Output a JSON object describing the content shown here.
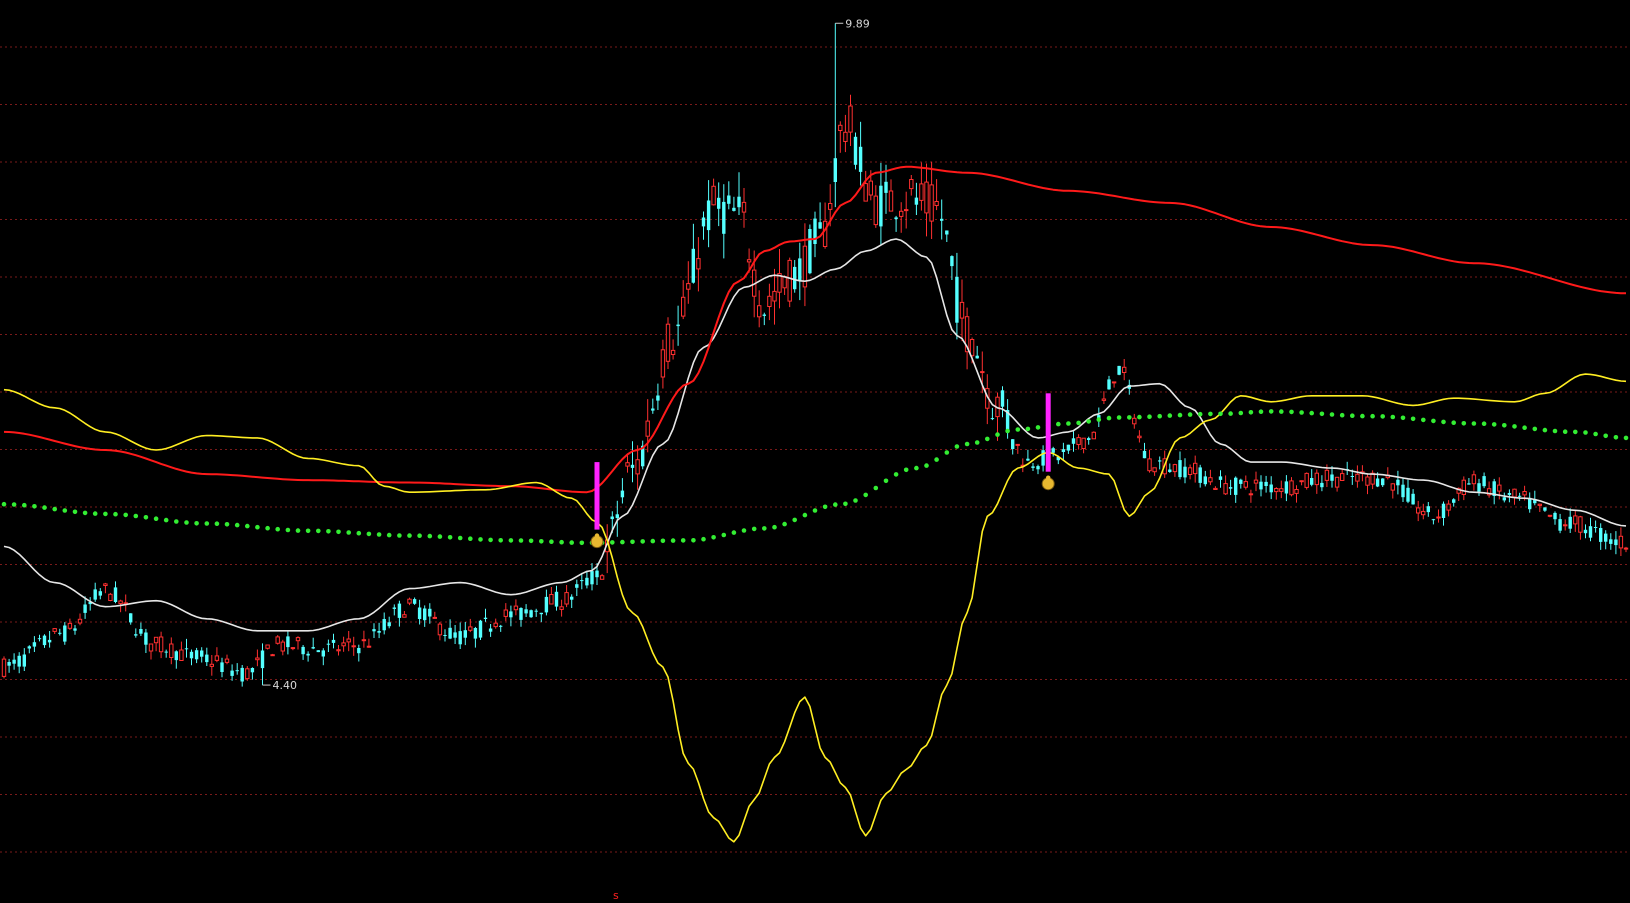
{
  "colors": {
    "background": "#000000",
    "grid": "#7a1a1a",
    "up": "#ff3030",
    "down": "#54ffff",
    "ma_white": "#e6e6e6",
    "ma_red": "#ff1a1a",
    "band_yellow": "#ffee22",
    "dots_green": "#33ee33",
    "signal_magenta": "#ff22ff",
    "signal_icon": "#e8b830"
  },
  "chart_data": {
    "type": "candlestick",
    "grid": true,
    "bars": 321,
    "ylim": [
      2.7,
      10.0
    ],
    "annotations": {
      "high": {
        "value": 9.89,
        "bar": 164,
        "text": "9.89"
      },
      "low": {
        "value": 4.4,
        "bar": 51,
        "text": "4.40"
      },
      "bottom_marker": {
        "text": "s"
      }
    },
    "signals": [
      {
        "bar": 117,
        "top": 6.25,
        "bottom": 5.69,
        "icon": "money-bag-icon"
      },
      {
        "bar": 206,
        "top": 6.82,
        "bottom": 6.17,
        "icon": "money-bag-icon"
      }
    ],
    "series": [
      {
        "style": "candles",
        "path": [
          [
            0,
            4.55
          ],
          [
            12,
            4.83
          ],
          [
            20,
            5.18
          ],
          [
            30,
            4.73
          ],
          [
            38,
            4.63
          ],
          [
            48,
            4.5
          ],
          [
            54,
            4.73
          ],
          [
            64,
            4.7
          ],
          [
            70,
            4.73
          ],
          [
            80,
            5.05
          ],
          [
            90,
            4.8
          ],
          [
            100,
            4.98
          ],
          [
            110,
            5.1
          ],
          [
            117,
            5.3
          ],
          [
            124,
            6.18
          ],
          [
            132,
            7.3
          ],
          [
            140,
            8.35
          ],
          [
            145,
            8.3
          ],
          [
            150,
            7.55
          ],
          [
            156,
            7.8
          ],
          [
            161,
            8.1
          ],
          [
            166,
            9.05
          ],
          [
            172,
            8.4
          ],
          [
            178,
            8.45
          ],
          [
            184,
            8.35
          ],
          [
            190,
            7.35
          ],
          [
            196,
            6.72
          ],
          [
            202,
            6.25
          ],
          [
            208,
            6.3
          ],
          [
            214,
            6.45
          ],
          [
            220,
            7.02
          ],
          [
            226,
            6.25
          ],
          [
            232,
            6.2
          ],
          [
            242,
            6.05
          ],
          [
            252,
            6.05
          ],
          [
            262,
            6.12
          ],
          [
            272,
            6.12
          ],
          [
            282,
            5.8
          ],
          [
            290,
            6.08
          ],
          [
            298,
            5.95
          ],
          [
            308,
            5.75
          ],
          [
            320,
            5.58
          ]
        ]
      },
      {
        "style": "line",
        "color_key": "ma_white",
        "path": [
          [
            0,
            5.55
          ],
          [
            10,
            5.25
          ],
          [
            20,
            5.05
          ],
          [
            30,
            5.1
          ],
          [
            40,
            4.95
          ],
          [
            50,
            4.85
          ],
          [
            60,
            4.85
          ],
          [
            70,
            4.95
          ],
          [
            80,
            5.2
          ],
          [
            90,
            5.25
          ],
          [
            100,
            5.15
          ],
          [
            110,
            5.25
          ],
          [
            116,
            5.35
          ],
          [
            122,
            5.8
          ],
          [
            130,
            6.4
          ],
          [
            138,
            7.2
          ],
          [
            146,
            7.7
          ],
          [
            152,
            7.8
          ],
          [
            158,
            7.75
          ],
          [
            164,
            7.85
          ],
          [
            170,
            8.0
          ],
          [
            176,
            8.1
          ],
          [
            182,
            7.95
          ],
          [
            188,
            7.3
          ],
          [
            196,
            6.7
          ],
          [
            204,
            6.45
          ],
          [
            210,
            6.5
          ],
          [
            216,
            6.65
          ],
          [
            222,
            6.88
          ],
          [
            228,
            6.9
          ],
          [
            234,
            6.7
          ],
          [
            240,
            6.4
          ],
          [
            246,
            6.25
          ],
          [
            252,
            6.25
          ],
          [
            262,
            6.2
          ],
          [
            270,
            6.15
          ],
          [
            280,
            6.1
          ],
          [
            290,
            6.0
          ],
          [
            300,
            5.95
          ],
          [
            310,
            5.85
          ],
          [
            320,
            5.72
          ]
        ]
      },
      {
        "style": "line",
        "color_key": "ma_red",
        "path": [
          [
            0,
            6.5
          ],
          [
            20,
            6.35
          ],
          [
            40,
            6.15
          ],
          [
            60,
            6.1
          ],
          [
            80,
            6.08
          ],
          [
            100,
            6.05
          ],
          [
            115,
            6.0
          ],
          [
            125,
            6.35
          ],
          [
            135,
            6.9
          ],
          [
            145,
            7.75
          ],
          [
            150,
            8.0
          ],
          [
            155,
            8.08
          ],
          [
            160,
            8.1
          ],
          [
            166,
            8.4
          ],
          [
            172,
            8.65
          ],
          [
            178,
            8.7
          ],
          [
            190,
            8.65
          ],
          [
            210,
            8.5
          ],
          [
            230,
            8.4
          ],
          [
            250,
            8.2
          ],
          [
            270,
            8.05
          ],
          [
            290,
            7.9
          ],
          [
            320,
            7.65
          ]
        ]
      },
      {
        "style": "line",
        "color_key": "band_yellow",
        "path": [
          [
            0,
            6.85
          ],
          [
            10,
            6.7
          ],
          [
            20,
            6.5
          ],
          [
            30,
            6.35
          ],
          [
            40,
            6.47
          ],
          [
            50,
            6.45
          ],
          [
            60,
            6.28
          ],
          [
            70,
            6.22
          ],
          [
            75,
            6.05
          ],
          [
            80,
            6.0
          ],
          [
            95,
            6.02
          ],
          [
            105,
            6.08
          ],
          [
            112,
            5.95
          ],
          [
            117,
            5.75
          ],
          [
            124,
            5.0
          ],
          [
            130,
            4.55
          ],
          [
            135,
            3.75
          ],
          [
            140,
            3.3
          ],
          [
            144,
            3.1
          ],
          [
            148,
            3.45
          ],
          [
            152,
            3.8
          ],
          [
            158,
            4.3
          ],
          [
            162,
            3.8
          ],
          [
            166,
            3.55
          ],
          [
            170,
            3.15
          ],
          [
            174,
            3.5
          ],
          [
            178,
            3.7
          ],
          [
            182,
            3.9
          ],
          [
            186,
            4.4
          ],
          [
            190,
            5.0
          ],
          [
            194,
            5.8
          ],
          [
            200,
            6.2
          ],
          [
            206,
            6.33
          ],
          [
            212,
            6.2
          ],
          [
            218,
            6.15
          ],
          [
            222,
            5.8
          ],
          [
            226,
            6.0
          ],
          [
            232,
            6.45
          ],
          [
            238,
            6.6
          ],
          [
            244,
            6.8
          ],
          [
            250,
            6.75
          ],
          [
            258,
            6.8
          ],
          [
            268,
            6.8
          ],
          [
            278,
            6.72
          ],
          [
            286,
            6.78
          ],
          [
            298,
            6.75
          ],
          [
            304,
            6.82
          ],
          [
            312,
            6.98
          ],
          [
            320,
            6.92
          ]
        ]
      },
      {
        "style": "dots",
        "color_key": "dots_green",
        "path": [
          [
            0,
            5.9
          ],
          [
            20,
            5.82
          ],
          [
            40,
            5.74
          ],
          [
            60,
            5.68
          ],
          [
            80,
            5.64
          ],
          [
            100,
            5.6
          ],
          [
            115,
            5.58
          ],
          [
            135,
            5.6
          ],
          [
            150,
            5.7
          ],
          [
            165,
            5.9
          ],
          [
            180,
            6.2
          ],
          [
            190,
            6.4
          ],
          [
            200,
            6.52
          ],
          [
            210,
            6.57
          ],
          [
            220,
            6.62
          ],
          [
            240,
            6.65
          ],
          [
            250,
            6.67
          ],
          [
            270,
            6.63
          ],
          [
            290,
            6.57
          ],
          [
            310,
            6.5
          ],
          [
            320,
            6.45
          ]
        ]
      }
    ]
  }
}
